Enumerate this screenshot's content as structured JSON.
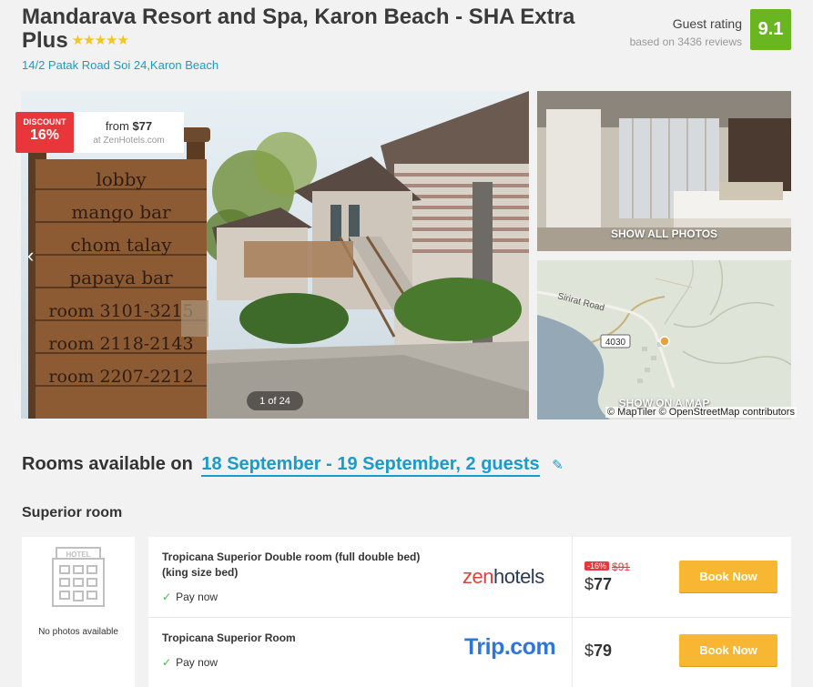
{
  "hotel": {
    "name": "Mandarava Resort and Spa, Karon Beach - SHA Extra Plus",
    "stars": "★★★★★",
    "address": "14/2 Patak Road Soi 24,Karon Beach"
  },
  "rating": {
    "label": "Guest rating",
    "reviews": "based on 3436 reviews",
    "score": "9.1"
  },
  "gallery": {
    "discount_label": "DISCOUNT",
    "discount_value": "16%",
    "from_prefix": "from ",
    "from_price": "$77",
    "from_source": "at ZenHotels.com",
    "counter": "1 of 24",
    "prev_arrow": "‹",
    "show_all_photos": "SHOW ALL PHOTOS",
    "show_on_map": "SHOW ON A MAP",
    "map_attribution": "© MapTiler © OpenStreetMap contributors",
    "map_road_label": "4030",
    "map_street_label": "Sirirat Road",
    "sign_lines": [
      "lobby",
      "mango bar",
      "chom talay",
      "papaya bar",
      "room 3101-3215",
      "room 2118-2143",
      "room 2207-2212"
    ]
  },
  "rooms": {
    "heading": "Rooms available on",
    "dates": "18 September - 19 September, 2 guests",
    "room_name": "Superior room",
    "no_photos": "No photos available",
    "hotel_icon_label": "HOTEL",
    "offers": [
      {
        "name": "Tropicana Superior Double room (full double bed) (king size bed)",
        "payment": "Pay now",
        "provider": "zenhotels",
        "discount": "-16%",
        "old_price": "$91",
        "currency": "$",
        "price": "77",
        "button": "Book Now"
      },
      {
        "name": "Tropicana Superior Room",
        "payment": "Pay now",
        "provider": "Trip.com",
        "currency": "$",
        "price": "79",
        "button": "Book Now"
      }
    ]
  },
  "colors": {
    "accent": "#1a9bc9",
    "rating_green": "#6ab620",
    "discount_red": "#e9363b",
    "button_yellow": "#f7b732"
  }
}
